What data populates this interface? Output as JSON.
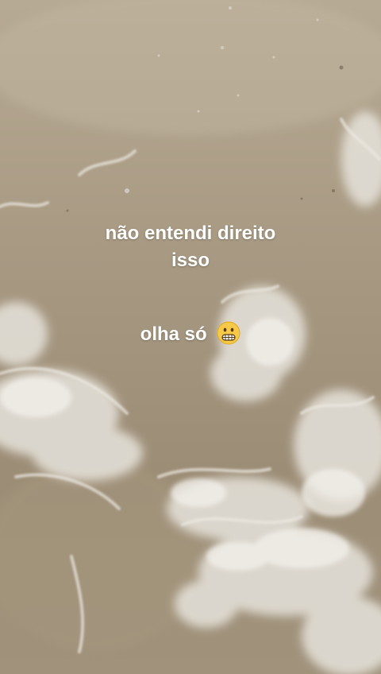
{
  "caption": {
    "line1": "não entendi direito",
    "line2": "isso",
    "line3": "olha só",
    "emoji": "grimacing-face-icon"
  }
}
